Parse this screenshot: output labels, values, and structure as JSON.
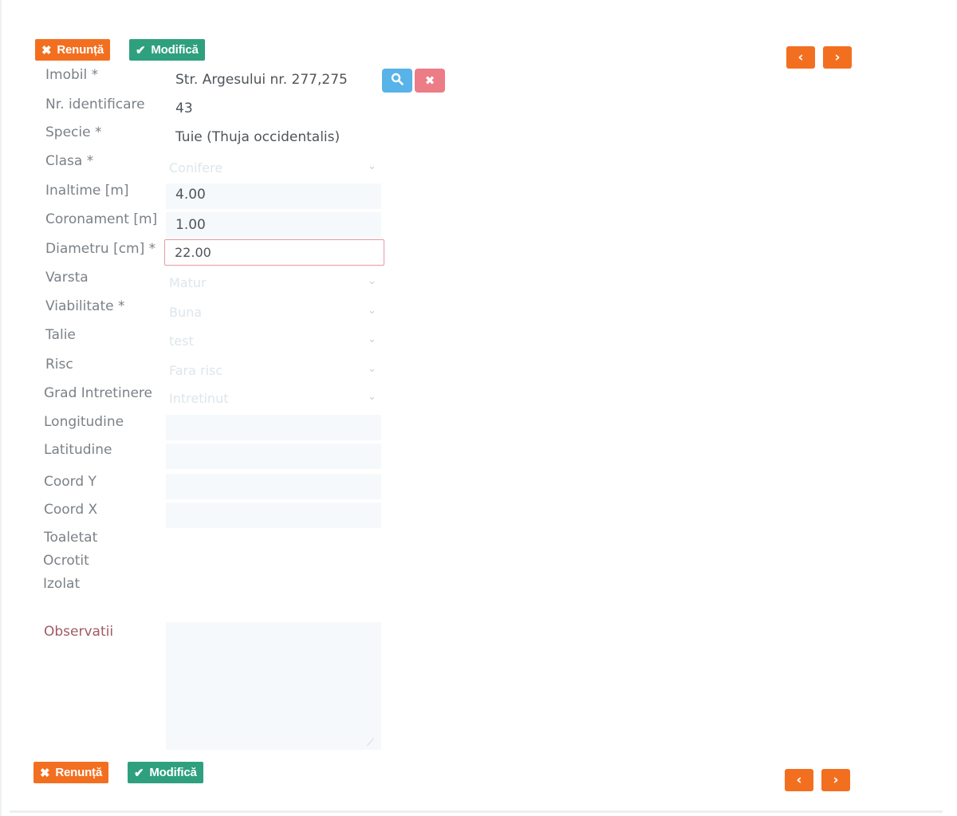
{
  "toolbar": {
    "cancel_label": "Renunță",
    "save_label": "Modifică"
  },
  "icons": {
    "cancel": "close-icon",
    "save": "check-icon",
    "prev": "chevron-left-icon",
    "next": "chevron-right-icon",
    "search": "search-icon",
    "clear": "close-icon"
  },
  "colors": {
    "accent_orange": "#f36f20",
    "accent_green": "#2fa07d",
    "search_blue": "#57b3e8",
    "clear_red": "#ec7c86",
    "error_border": "#e79aa2"
  },
  "form": {
    "imobil": {
      "label": "Imobil *",
      "value": "Str. Argesului nr. 277,275"
    },
    "nr_identificare": {
      "label": "Nr. identificare",
      "value": "43"
    },
    "specie": {
      "label": "Specie *",
      "value": "Tuie (Thuja occidentalis)"
    },
    "clasa": {
      "label": "Clasa *",
      "value": "Conifere"
    },
    "inaltime": {
      "label": "Inaltime [m]",
      "value": "4.00"
    },
    "coronament": {
      "label": "Coronament [m]",
      "value": "1.00"
    },
    "diametru": {
      "label": "Diametru [cm] *",
      "value": "22.00"
    },
    "varsta": {
      "label": "Varsta",
      "value": "Matur"
    },
    "viabilitate": {
      "label": "Viabilitate *",
      "value": "Buna"
    },
    "talie": {
      "label": "Talie",
      "value": "test"
    },
    "risc": {
      "label": "Risc",
      "value": "Fara risc"
    },
    "grad_intretinere": {
      "label": "Grad Intretinere",
      "value": "Intretinut"
    },
    "longitudine": {
      "label": "Longitudine"
    },
    "latitudine": {
      "label": "Latitudine"
    },
    "coord_y": {
      "label": "Coord Y"
    },
    "coord_x": {
      "label": "Coord X"
    },
    "toaletat": {
      "label": "Toaletat"
    },
    "ocrotit": {
      "label": "Ocrotit"
    },
    "izolat": {
      "label": "Izolat"
    },
    "observatii": {
      "label": "Observatii"
    }
  }
}
